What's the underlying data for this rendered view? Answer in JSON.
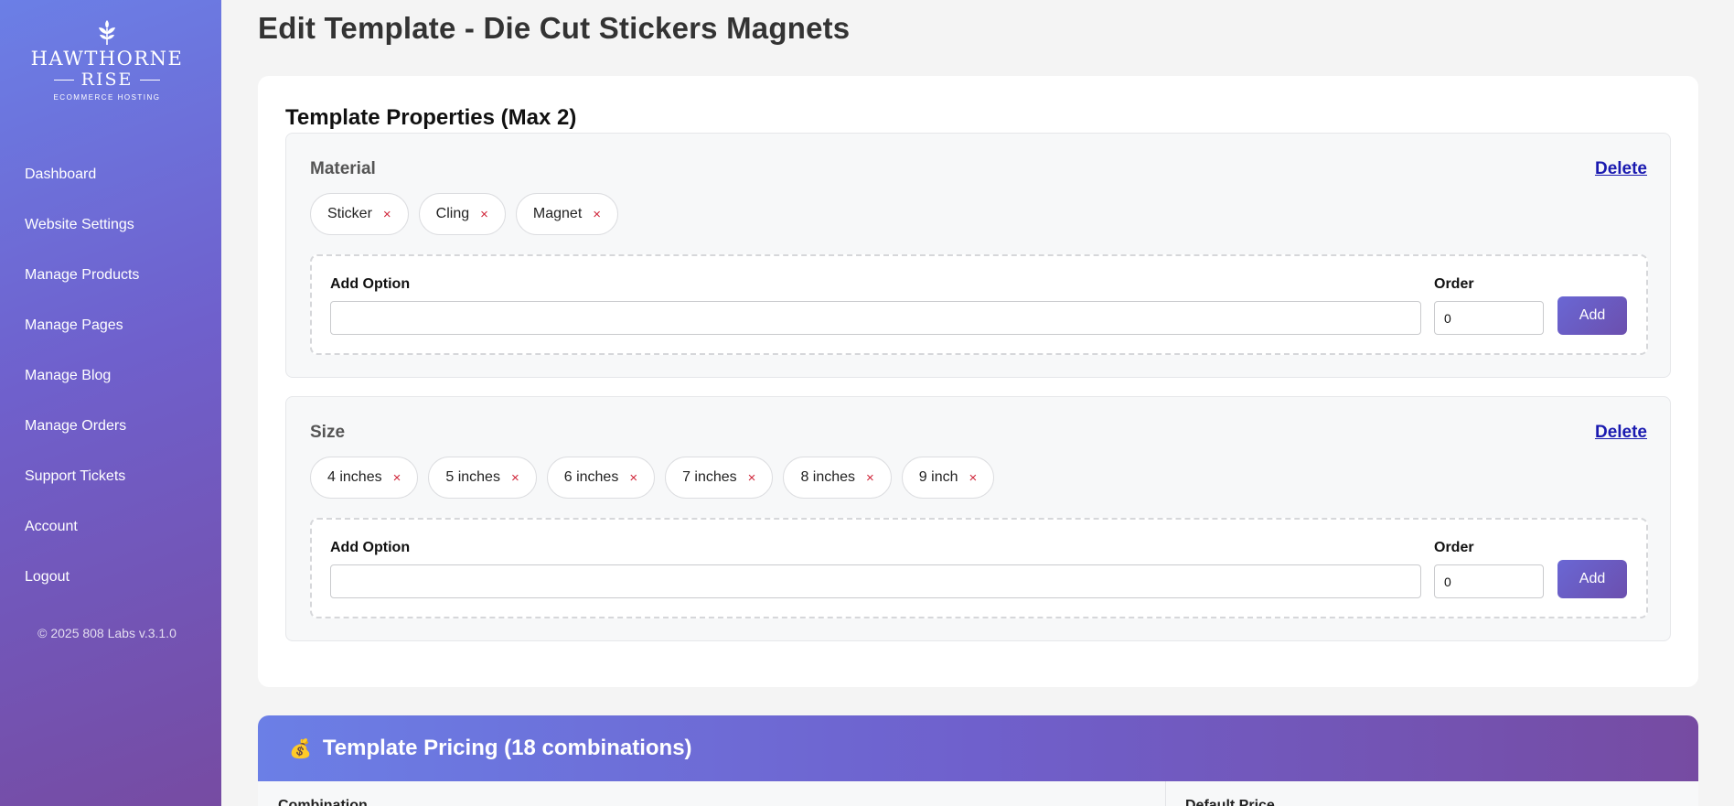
{
  "brand": {
    "line1": "HAWTHORNE",
    "line2": "RISE",
    "line3": "ECOMMERCE HOSTING"
  },
  "sidebar": {
    "items": [
      {
        "label": "Dashboard"
      },
      {
        "label": "Website Settings"
      },
      {
        "label": "Manage Products"
      },
      {
        "label": "Manage Pages"
      },
      {
        "label": "Manage Blog"
      },
      {
        "label": "Manage Orders"
      },
      {
        "label": "Support Tickets"
      },
      {
        "label": "Account"
      },
      {
        "label": "Logout"
      }
    ],
    "copyright": "© 2025 808 Labs v.3.1.0"
  },
  "page": {
    "title": "Edit Template - Die Cut Stickers Magnets"
  },
  "properties": {
    "heading": "Template Properties (Max 2)",
    "delete_label": "Delete",
    "add_option_label": "Add Option",
    "order_label": "Order",
    "add_button_label": "Add",
    "items": [
      {
        "name": "Material",
        "options": [
          "Sticker",
          "Cling",
          "Magnet"
        ],
        "new_option_value": "",
        "order_value": "0"
      },
      {
        "name": "Size",
        "options": [
          "4 inches",
          "5 inches",
          "6 inches",
          "7 inches",
          "8 inches",
          "9 inch"
        ],
        "new_option_value": "",
        "order_value": "0"
      }
    ]
  },
  "pricing": {
    "icon": "money-bag-icon",
    "heading": "Template Pricing (18 combinations)",
    "columns": [
      "Combination",
      "Default Price"
    ]
  },
  "icons": {
    "remove": "×",
    "money_bag": "💰"
  },
  "colors": {
    "accent_start": "#6b7fe6",
    "accent_end": "#764ba2",
    "remove": "#d0263a",
    "link": "#1a1ab0"
  }
}
